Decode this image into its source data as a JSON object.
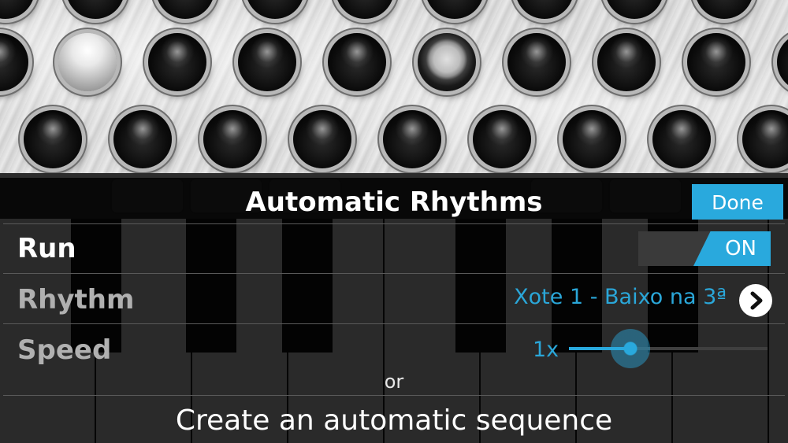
{
  "panel": {
    "title": "Automatic Rhythms",
    "done_label": "Done"
  },
  "run": {
    "label": "Run",
    "state": "ON"
  },
  "rhythm": {
    "label": "Rhythm",
    "value": "Xote 1 - Baixo na 3ª"
  },
  "speed": {
    "label": "Speed",
    "value": "1x",
    "slider_fraction": 0.31
  },
  "separator_text": "or",
  "create_sequence_label": "Create an automatic sequence",
  "colors": {
    "accent": "#29a9dd",
    "accent_text": "#2aa7d9",
    "overlay": "#000000",
    "dim_label": "#b0b0b0"
  },
  "icons": {
    "rhythm_more": "chevron-right-icon"
  }
}
